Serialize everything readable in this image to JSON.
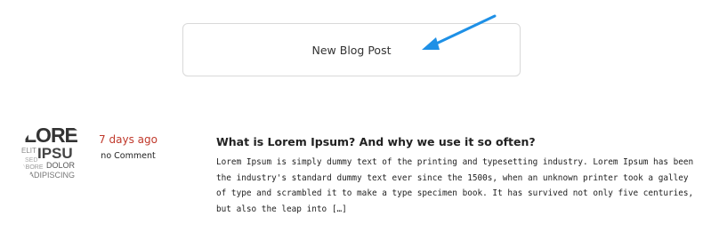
{
  "new_post": {
    "label": "New Blog Post"
  },
  "annotation": {
    "arrow_color": "#1e90e6"
  },
  "post": {
    "thumbnail_text": [
      "LORE",
      "IPSU",
      "ELIT",
      "SED",
      "ABORE",
      "DOLOR",
      "ADIPISCING"
    ],
    "date": "7 days ago",
    "comments": "no Comment",
    "title": "What is Lorem Ipsum? And why we use it so often?",
    "excerpt": "Lorem Ipsum is simply dummy text of the printing and typesetting industry. Lorem Ipsum has been the industry's standard dummy text ever since the 1500s, when an unknown printer took a galley of type and scrambled it to make a type specimen book. It has survived not only five centuries, but also the leap into […]",
    "date_color": "#c0392b"
  }
}
